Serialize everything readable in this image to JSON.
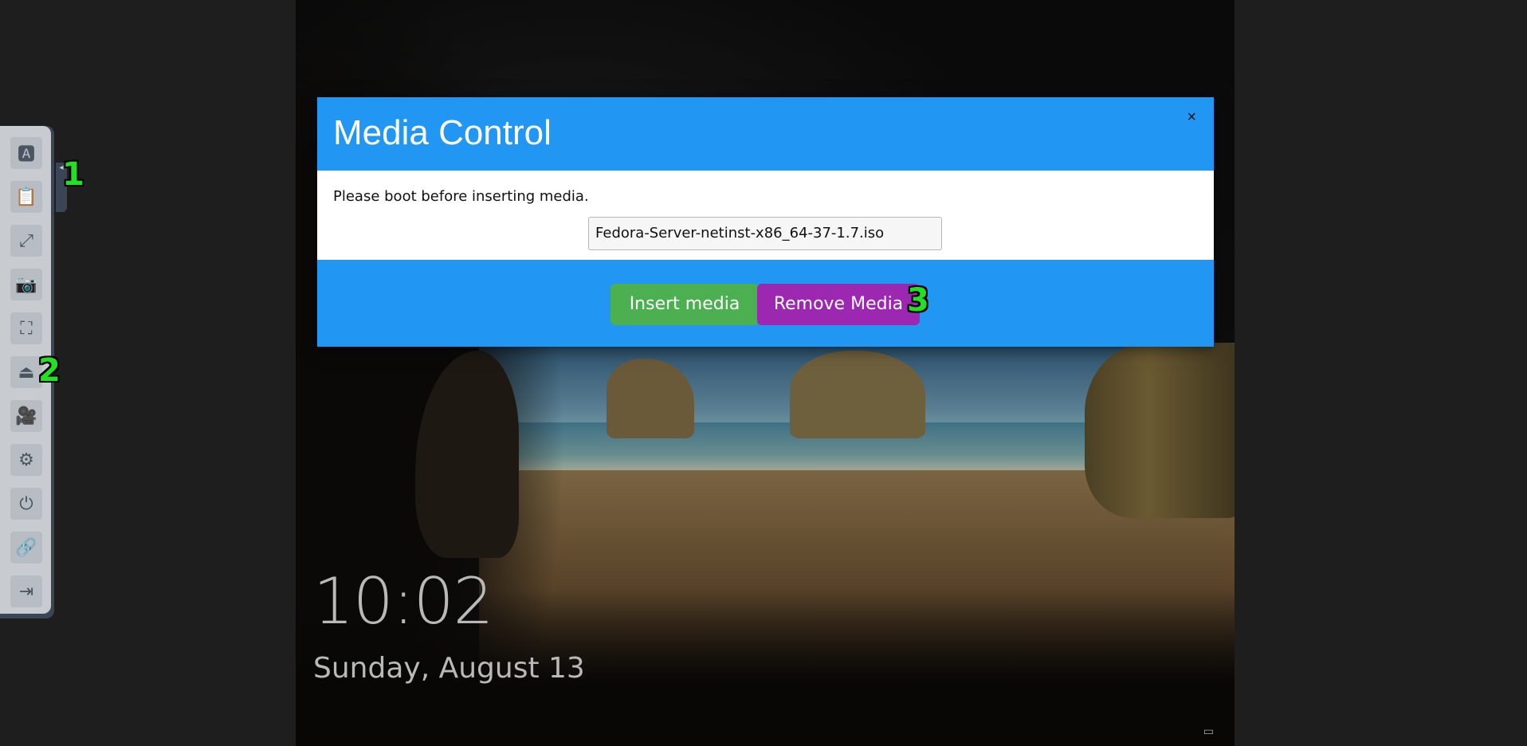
{
  "toolbar": {
    "items": [
      {
        "name": "keyboard-icon",
        "glyph": "🅰"
      },
      {
        "name": "clipboard-icon",
        "glyph": "📋"
      },
      {
        "name": "fullscreen-icon",
        "glyph": "⤢"
      },
      {
        "name": "camera-icon",
        "glyph": "📷"
      },
      {
        "name": "network-icon",
        "glyph": "⛶"
      },
      {
        "name": "eject-icon",
        "glyph": "⏏"
      },
      {
        "name": "video-icon",
        "glyph": "🎥"
      },
      {
        "name": "gear-icon",
        "glyph": "⚙"
      },
      {
        "name": "power-icon",
        "glyph": "⏻"
      },
      {
        "name": "disconnect-icon",
        "glyph": "🔗"
      },
      {
        "name": "logout-icon",
        "glyph": "⇥"
      }
    ],
    "grip_glyph": "◂"
  },
  "markers": {
    "one": "1",
    "two": "2",
    "three": "3"
  },
  "modal": {
    "title": "Media Control",
    "close_glyph": "×",
    "notice": "Please boot before inserting media.",
    "selected_media": "Fedora-Server-netinst-x86_64-37-1.7.iso",
    "insert_label": "Insert media",
    "remove_label": "Remove Media"
  },
  "lockscreen": {
    "time": "10:02",
    "date": "Sunday, August 13"
  },
  "colors": {
    "header_blue": "#2196f3",
    "insert_green": "#4caf50",
    "remove_purple": "#9c27b0",
    "marker_green": "#22e022"
  }
}
